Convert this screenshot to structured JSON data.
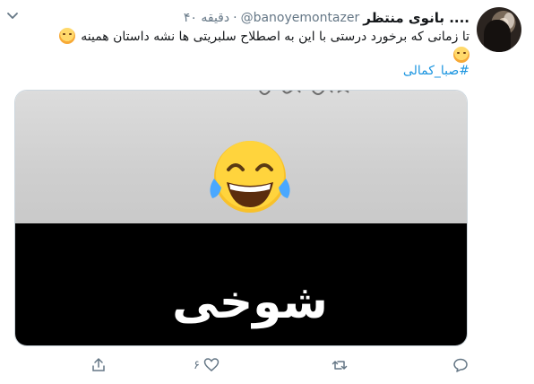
{
  "tweet": {
    "display_name": "بانوی منتظر ....",
    "handle": "@banoyemontazer",
    "separator": "·",
    "time": "۴۰ دقیقه",
    "text": "تا زمانی که برخورد درستی با این به اصطلاح سلبریتی ها نشه داستان همینه",
    "hashtag": "#صبا_کمالی",
    "media_caption": "شوخی",
    "like_count": "۶"
  },
  "icons": {
    "menu": "chevron-down-icon",
    "reply": "reply-icon",
    "retweet": "retweet-icon",
    "like": "heart-icon",
    "share": "share-icon"
  },
  "colors": {
    "link": "#1b95e0",
    "secondary_text": "#657786",
    "primary_text": "#14171a"
  }
}
